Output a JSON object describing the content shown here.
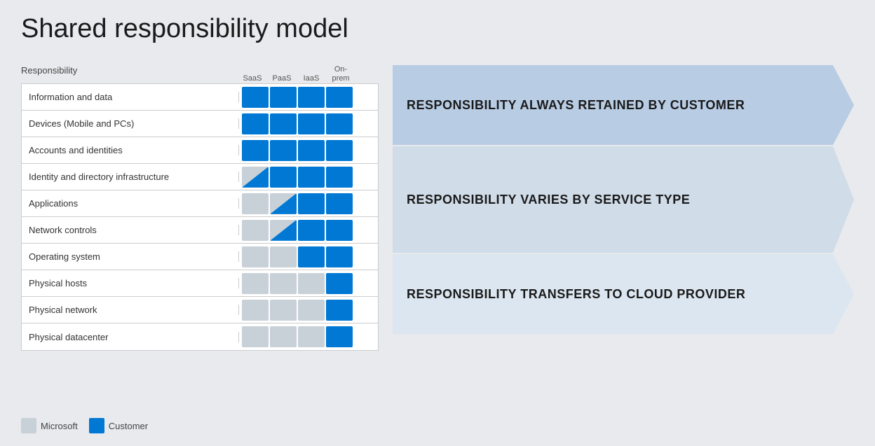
{
  "title": "Shared responsibility model",
  "table": {
    "columns": [
      "SaaS",
      "PaaS",
      "IaaS",
      "On-\nprem"
    ],
    "header_label": "Responsibility",
    "rows": [
      {
        "label": "Information and data",
        "cells": [
          "blue",
          "blue",
          "blue",
          "blue"
        ]
      },
      {
        "label": "Devices (Mobile and PCs)",
        "cells": [
          "blue",
          "blue",
          "blue",
          "blue"
        ]
      },
      {
        "label": "Accounts and identities",
        "cells": [
          "blue",
          "blue",
          "blue",
          "blue"
        ]
      },
      {
        "label": "Identity and directory infrastructure",
        "cells": [
          "split",
          "blue",
          "blue",
          "blue"
        ]
      },
      {
        "label": "Applications",
        "cells": [
          "gray",
          "split",
          "blue",
          "blue"
        ]
      },
      {
        "label": "Network controls",
        "cells": [
          "gray",
          "split",
          "blue",
          "blue"
        ]
      },
      {
        "label": "Operating system",
        "cells": [
          "gray",
          "gray",
          "blue",
          "blue"
        ]
      },
      {
        "label": "Physical hosts",
        "cells": [
          "gray",
          "gray",
          "gray",
          "blue"
        ]
      },
      {
        "label": "Physical network",
        "cells": [
          "gray",
          "gray",
          "gray",
          "blue"
        ]
      },
      {
        "label": "Physical datacenter",
        "cells": [
          "gray",
          "gray",
          "gray",
          "blue"
        ]
      }
    ]
  },
  "banners": [
    {
      "id": "banner-1",
      "text": "RESPONSIBILITY ALWAYS RETAINED BY CUSTOMER",
      "rows": 3
    },
    {
      "id": "banner-2",
      "text": "RESPONSIBILITY VARIES BY SERVICE TYPE",
      "rows": 4
    },
    {
      "id": "banner-3",
      "text": "RESPONSIBILITY TRANSFERS TO CLOUD PROVIDER",
      "rows": 3
    }
  ],
  "legend": {
    "microsoft_label": "Microsoft",
    "customer_label": "Customer"
  }
}
